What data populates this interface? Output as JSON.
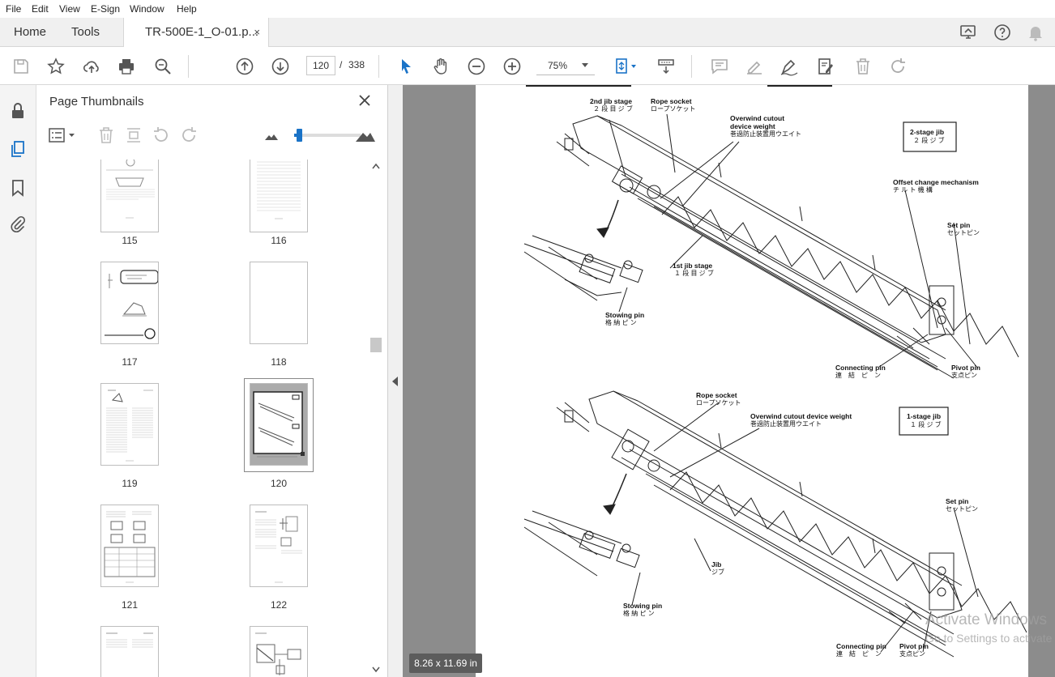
{
  "menu": {
    "file": "File",
    "edit": "Edit",
    "view": "View",
    "esign": "E-Sign",
    "window": "Window",
    "help": "Help"
  },
  "tabs": {
    "home": "Home",
    "tools": "Tools",
    "document": "TR-500E-1_O-01.p...",
    "close": "×"
  },
  "toolbar": {
    "page_current": "120",
    "page_separator": "/",
    "page_total": "338",
    "zoom": "75%"
  },
  "panel": {
    "title": "Page Thumbnails",
    "thumbnails": [
      {
        "label": "115"
      },
      {
        "label": "116"
      },
      {
        "label": "117"
      },
      {
        "label": "118"
      },
      {
        "label": "119"
      },
      {
        "label": "120"
      },
      {
        "label": "121"
      },
      {
        "label": "122"
      }
    ]
  },
  "document": {
    "page_size": "8.26 x 11.69 in",
    "labels": {
      "jib2_en": "2nd jib stage",
      "jib2_jp": "２ 段 目 ジ ブ",
      "rope1_en": "Rope socket",
      "rope1_jp": "ロープソケット",
      "overwind1_en": "Overwind cutout device weight",
      "overwind1_jp": "巻過防止装置用ウエイト",
      "stage2_en": "2-stage jib",
      "stage2_jp": "２ 段 ジ ブ",
      "offset_en": "Offset change mechanism",
      "offset_jp": "チ ル ト 機 構",
      "set1_en": "Set pin",
      "set1_jp": "セットピン",
      "jib1_en": "1st jib stage",
      "jib1_jp": "１ 段 目 ジ ブ",
      "stow1_en": "Stowing pin",
      "stow1_jp": "格 納 ピ ン",
      "conn1_en": "Connecting pin",
      "conn1_jp": "連　結　ピ　ン",
      "pivot1_en": "Pivot pin",
      "pivot1_jp": "支点ピン",
      "rope2_en": "Rope socket",
      "rope2_jp": "ロープソケット",
      "overwind2_en": "Overwind cutout device weight",
      "overwind2_jp": "巻過防止装置用ウエイト",
      "stage1_en": "1-stage jib",
      "stage1_jp": "１ 段 ジ ブ",
      "set2_en": "Set pin",
      "set2_jp": "セットピン",
      "jib_en": "Jib",
      "jib_jp": "ジブ",
      "stow2_en": "Stowing pin",
      "stow2_jp": "格 納 ピ ン",
      "conn2_en": "Connecting pin",
      "conn2_jp": "連　結　ピ　ン",
      "pivot2_en": "Pivot pin",
      "pivot2_jp": "支点ピン"
    }
  },
  "watermark": {
    "line1": "Activate Windows",
    "line2": "Go to Settings to activate"
  }
}
